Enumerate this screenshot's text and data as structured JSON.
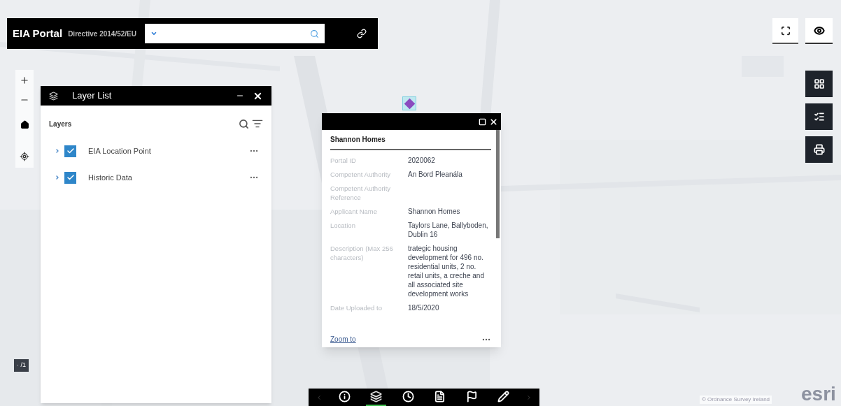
{
  "header": {
    "title": "EIA Portal",
    "subtitle": "Directive 2014/52/EU"
  },
  "layer_list": {
    "title": "Layer List",
    "heading": "Layers",
    "layers": [
      {
        "label": "EIA Location Point",
        "checked": true
      },
      {
        "label": "Historic Data",
        "checked": true
      }
    ]
  },
  "popup": {
    "title": "Shannon Homes",
    "fields": [
      {
        "label": "Portal ID",
        "value": "2020062"
      },
      {
        "label": "Competent Authority",
        "value": "An Bord Pleanála"
      },
      {
        "label": "Competent Authority Reference"
      },
      {
        "label": "Applicant Name",
        "value": "Shannon Homes"
      },
      {
        "label": "Location",
        "value": "Taylors Lane, Ballyboden, Dublin 16"
      },
      {
        "label": "Description (Max 256 characters)",
        "value": "trategic housing development for 496 no. residential units, 2 no. retail units, a creche and all associated site development works"
      },
      {
        "label": "Date Uploaded to",
        "value": "18/5/2020"
      }
    ],
    "link": "Zoom to"
  },
  "toolbar": {
    "items": [
      {
        "kind": "info",
        "selected": false
      },
      {
        "kind": "layers",
        "selected": true
      },
      {
        "kind": "time",
        "selected": false
      },
      {
        "kind": "list",
        "selected": false
      },
      {
        "kind": "flag",
        "selected": false
      },
      {
        "kind": "draw",
        "selected": false
      }
    ]
  },
  "scale": "· /1",
  "attribution": "© Ordnance Survey Ireland",
  "logo": "esri"
}
